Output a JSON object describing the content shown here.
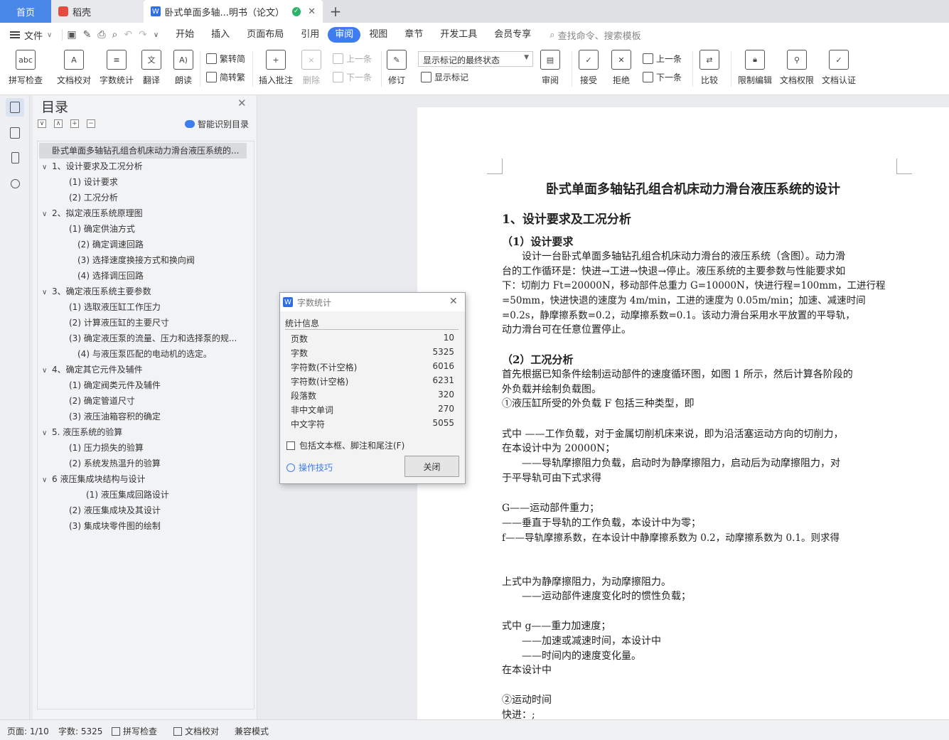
{
  "tabs": {
    "home": "首页",
    "daoke": "稻壳",
    "doc": "卧式单面多轴...明书（论文）",
    "plus": "+"
  },
  "menu": {
    "file": "文件",
    "items": [
      "开始",
      "插入",
      "页面布局",
      "引用",
      "审阅",
      "视图",
      "章节",
      "开发工具",
      "会员专享"
    ],
    "active": "审阅",
    "search_placeholder": "查找命令、搜索模板"
  },
  "ribbon": {
    "spell": "拼写检查",
    "proof": "文档校对",
    "wordcount": "字数统计",
    "translate": "翻译",
    "read": "朗读",
    "trad": "繁转简",
    "simp": "简转繁",
    "comment": "插入批注",
    "delete": "删除",
    "prev": "上一条",
    "next": "下一条",
    "track": "修订",
    "markup_state": "显示标记的最终状态",
    "show_markup": "显示标记",
    "review": "审阅",
    "accept": "接受",
    "reject": "拒绝",
    "prev2": "上一条",
    "next2": "下一条",
    "compare": "比较",
    "restrict": "限制编辑",
    "perm": "文档权限",
    "cert": "文档认证"
  },
  "toc": {
    "title": "目录",
    "smart": "智能识别目录",
    "items": [
      "卧式单面多轴钻孔组合机床动力滑台液压系统的...",
      "1、设计要求及工况分析",
      "(1) 设计要求",
      "(2) 工况分析",
      "2、拟定液压系统原理图",
      "(1) 确定供油方式",
      "(2) 确定调速回路",
      "(3) 选择速度换接方式和换向阀",
      "(4) 选择调压回路",
      "3、确定液压系统主要参数",
      "(1) 选取液压缸工作压力",
      "(2) 计算液压缸的主要尺寸",
      "(3) 确定液压泵的流量、压力和选择泵的规...",
      "(4) 与液压泵匹配的电动机的选定。",
      "4、确定其它元件及辅件",
      "(1) 确定阀类元件及辅件",
      "(2) 确定管道尺寸",
      "(3) 液压油箱容积的确定",
      "5. 液压系统的验算",
      "(1) 压力损失的验算",
      "(2) 系统发热温升的验算",
      "6 液压集成块结构与设计",
      "(1) 液压集成回路设计",
      "(2) 液压集成块及其设计",
      "(3) 集成块零件图的绘制"
    ]
  },
  "document": {
    "lines": [
      "卧式单面多轴钻孔组合机床动力滑台液压系统的设计",
      "1、设计要求及工况分析",
      "（1）设计要求",
      "　　设计一台卧式单面多轴钻孔组合机床动力滑台的液压系统（含图）。动力滑",
      "台的工作循环是：快进→工进→快退→停止。液压系统的主要参数与性能要求如",
      "下：切削力 Ft=20000N，移动部件总重力 G=10000N，快进行程=100mm，工进行程",
      "=50mm，快进快退的速度为 4m/min，工进的速度为 0.05m/min；加速、减速时间",
      "=0.2s，静摩擦系数=0.2，动摩擦系数=0.1。该动力滑台采用水平放置的平导轨，",
      "动力滑台可在任意位置停止。",
      "（2）工况分析",
      "首先根据已知条件绘制运动部件的速度循环图，如图 1 所示，然后计算各阶段的",
      "外负载并绘制负载图。",
      "①液压缸所受的外负载 F 包括三种类型，即",
      "式中 ——工作负载，对于金属切削机床来说，即为沿活塞运动方向的切削力，",
      "在本设计中为 20000N；",
      "　　——导轨摩擦阻力负载，启动时为静摩擦阻力，启动后为动摩擦阻力，对",
      "于平导轨可由下式求得",
      "G——运动部件重力；",
      "——垂直于导轨的工作负载，本设计中为零；",
      "f——导轨摩擦系数，在本设计中静摩擦系数为 0.2，动摩擦系数为 0.1。则求得",
      "上式中为静摩擦阻力，为动摩擦阻力。",
      "　　——运动部件速度变化时的惯性负载；",
      "式中 g——重力加速度；",
      "　　——加速或减速时间，本设计中",
      "　　——时间内的速度变化量。",
      "在本设计中",
      "②运动时间",
      "快进：;"
    ]
  },
  "dialog": {
    "title": "字数统计",
    "section": "统计信息",
    "rows": [
      {
        "label": "页数",
        "value": "10"
      },
      {
        "label": "字数",
        "value": "5325"
      },
      {
        "label": "字符数(不计空格)",
        "value": "6016"
      },
      {
        "label": "字符数(计空格)",
        "value": "6231"
      },
      {
        "label": "段落数",
        "value": "320"
      },
      {
        "label": "非中文单词",
        "value": "270"
      },
      {
        "label": "中文字符",
        "value": "5055"
      }
    ],
    "include": "包括文本框、脚注和尾注(F)",
    "tips": "操作技巧",
    "close": "关闭"
  },
  "status": {
    "page": "页面: 1/10",
    "words": "字数: 5325",
    "spell": "拼写检查",
    "proof": "文档校对",
    "compat": "兼容模式"
  }
}
